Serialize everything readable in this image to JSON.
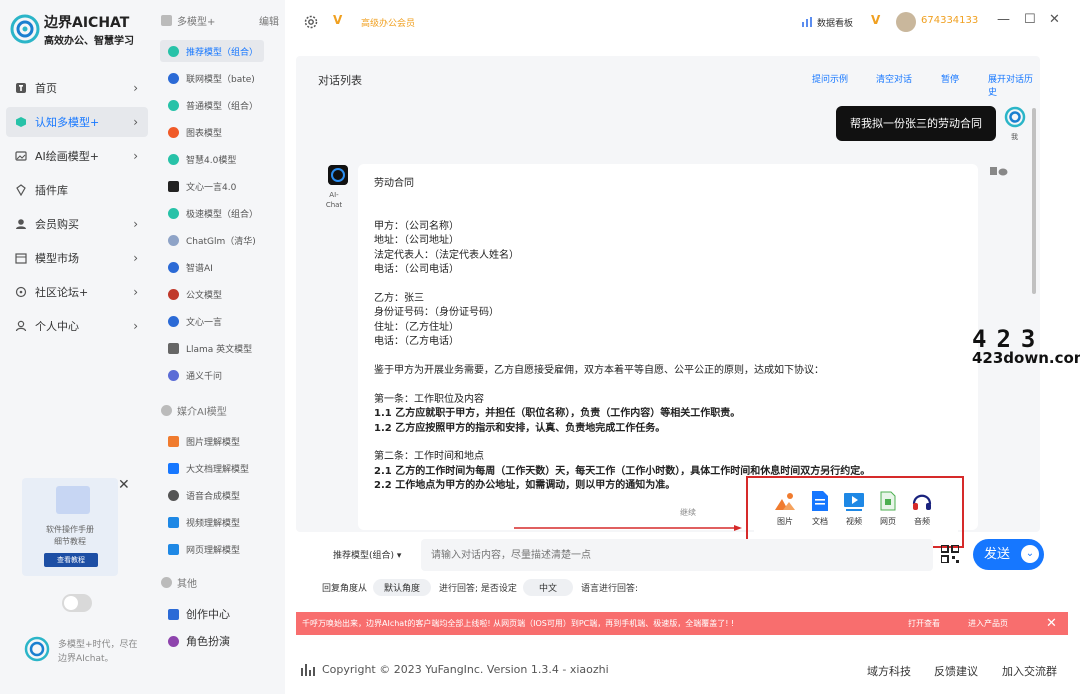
{
  "brand": {
    "name": "边界AICHAT",
    "tagline": "高效办公、智慧学习"
  },
  "nav": [
    {
      "label": "首页",
      "icon": "home-icon"
    },
    {
      "label": "认知多模型+",
      "icon": "cube-icon",
      "active": true
    },
    {
      "label": "AI绘画模型+",
      "icon": "image-icon"
    },
    {
      "label": "插件库",
      "icon": "plugin-icon"
    },
    {
      "label": "会员购买",
      "icon": "user-icon"
    },
    {
      "label": "模型市场",
      "icon": "store-icon"
    },
    {
      "label": "社区论坛+",
      "icon": "forum-icon"
    },
    {
      "label": "个人中心",
      "icon": "person-icon"
    }
  ],
  "promo": {
    "line1": "软件操作手册",
    "line2": "细节教程",
    "button": "查看教程"
  },
  "footer_brand": {
    "text": "多模型+时代，尽在边界AIchat。"
  },
  "models": {
    "section1": "多模型+",
    "edit": "编辑",
    "items": [
      "推荐模型（组合）",
      "联网模型（bate)",
      "普通模型（组合）",
      "图表模型",
      "智慧4.0模型",
      "文心一言4.0",
      "极速模型（组合）",
      "ChatGlm（清华)",
      "智谱AI",
      "公文模型",
      "文心一言",
      "Llama 英文模型",
      "通义千问"
    ],
    "section2": "媒介AI模型",
    "media": [
      "图片理解模型",
      "大文档理解模型",
      "语音合成模型",
      "视频理解模型",
      "网页理解模型"
    ],
    "section3": "其他",
    "other": [
      "创作中心",
      "角色扮演"
    ]
  },
  "topbar": {
    "vip_badge": "V",
    "vip_text": "高级办公会员",
    "dashboard": "数据看板",
    "user_vip": "V",
    "user_id": "674334133"
  },
  "chat": {
    "title": "对话列表",
    "actions": [
      "提问示例",
      "清空对话",
      "暂停",
      "展开对话历史"
    ],
    "user_message": "帮我拟一份张三的劳动合同",
    "user_label": "我",
    "ai_label": "AI-Chat",
    "reply_lines": [
      {
        "t": "劳动合同",
        "b": false
      },
      {
        "t": "甲方：（公司名称）",
        "b": false
      },
      {
        "t": "地址：（公司地址）",
        "b": false
      },
      {
        "t": "法定代表人：（法定代表人姓名）",
        "b": false
      },
      {
        "t": "电话：（公司电话）",
        "b": false
      },
      {
        "t": "乙方：张三",
        "b": false
      },
      {
        "t": "身份证号码：（身份证号码）",
        "b": false
      },
      {
        "t": "住址：（乙方住址）",
        "b": false
      },
      {
        "t": "电话：（乙方电话）",
        "b": false
      },
      {
        "t": "鉴于甲方为开展业务需要，乙方自愿接受雇佣，双方本着平等自愿、公平公正的原则，达成如下协议：",
        "b": false
      },
      {
        "t": "第一条：工作职位及内容",
        "b": false
      },
      {
        "t": "1.1 乙方应就职于甲方，并担任（职位名称），负责（工作内容）等相关工作职责。",
        "b": true
      },
      {
        "t": "1.2 乙方应按照甲方的指示和安排，认真、负责地完成工作任务。",
        "b": true
      },
      {
        "t": "第二条：工作时间和地点",
        "b": false
      },
      {
        "t": "2.1 乙方的工作时间为每周（工作天数）天，每天工作（工作小时数），具体工作时间和休息时间双方另行约定。",
        "b": true
      },
      {
        "t": "2.2 工作地点为甲方的办公地址，如需调动，则以甲方的通知为准。",
        "b": true
      }
    ],
    "continue": "继续"
  },
  "tools": [
    {
      "label": "图片",
      "icon": "picture-icon",
      "color": "#f07b2e"
    },
    {
      "label": "文档",
      "icon": "document-icon",
      "color": "#1677ff"
    },
    {
      "label": "视频",
      "icon": "video-icon",
      "color": "#1e88e5"
    },
    {
      "label": "网页",
      "icon": "webpage-icon",
      "color": "#4caf50"
    },
    {
      "label": "音频",
      "icon": "headphones-icon",
      "color": "#1a237e"
    }
  ],
  "input": {
    "model_select": "推荐模型(组合)",
    "placeholder": "请输入对话内容，尽量描述清楚一点",
    "send": "发送"
  },
  "options": {
    "angle_label": "回复角度从",
    "angle_value": "默认角度",
    "answer_label": "进行回答; 是否设定",
    "lang_value": "中文",
    "lang_suffix": "语言进行回答:"
  },
  "banner": {
    "text": "千呼万唤始出来，边界AIchat的客户端均全部上线啦! 从网页端（IOS可用）到PC端，再到手机端、极速版，全端覆盖了! !",
    "open": "打开查看",
    "enter": "进入产品页",
    "close": "✕"
  },
  "footer": {
    "copyright": "Copyright © 2023 YuFangInc. Version 1.3.4 - xiaozhi",
    "links": [
      "域方科技",
      "反馈建议",
      "加入交流群"
    ]
  },
  "watermark": {
    "big": "423",
    "small": "423down.com"
  },
  "colors": {
    "accent": "#1677ff",
    "vip": "#f0a020",
    "banner": "#f86e6e",
    "highlight_box": "#d62a2a"
  }
}
